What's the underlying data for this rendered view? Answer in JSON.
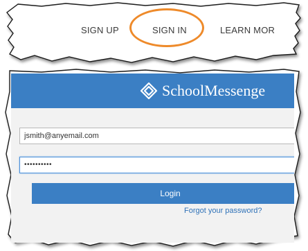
{
  "nav": {
    "sign_up": "SIGN UP",
    "sign_in": "SIGN IN",
    "learn_more": "LEARN MOR",
    "highlight_color": "#ee8a2a"
  },
  "login": {
    "brand_name": "SchoolMessenge",
    "brand_icon": "schoolmessenger-logo-icon",
    "header_color": "#3b7fc4",
    "email_value": "jsmith@anyemail.com",
    "password_value": "••••••••••",
    "login_label": "Login",
    "forgot_label": "Forgot your password?"
  }
}
